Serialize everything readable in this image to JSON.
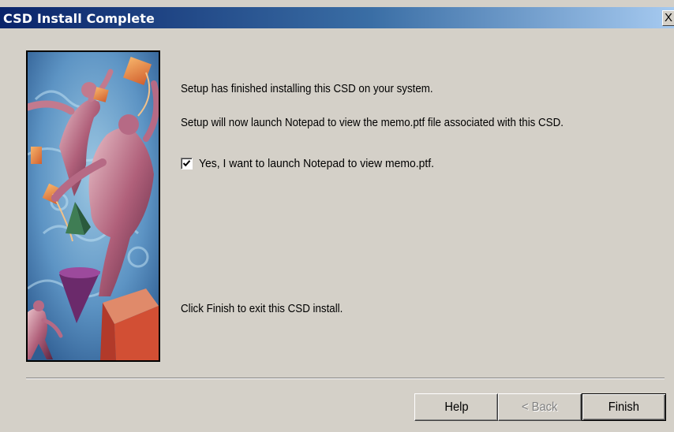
{
  "window": {
    "title": "CSD Install Complete",
    "close_glyph": "X"
  },
  "content": {
    "line1": "Setup has finished installing this CSD on your system.",
    "line2": "Setup will now launch Notepad to view the memo.ptf file associated with this CSD.",
    "checkbox_label": "Yes, I want to launch Notepad to view memo.ptf.",
    "checkbox_checked": true,
    "finish_text": "Click Finish to exit this CSD install."
  },
  "buttons": {
    "help": "Help",
    "back": "< Back",
    "finish": "Finish"
  },
  "colors": {
    "titlebar_start": "#0a246a",
    "titlebar_end": "#a6caf0",
    "dialog_bg": "#d4d0c8"
  }
}
